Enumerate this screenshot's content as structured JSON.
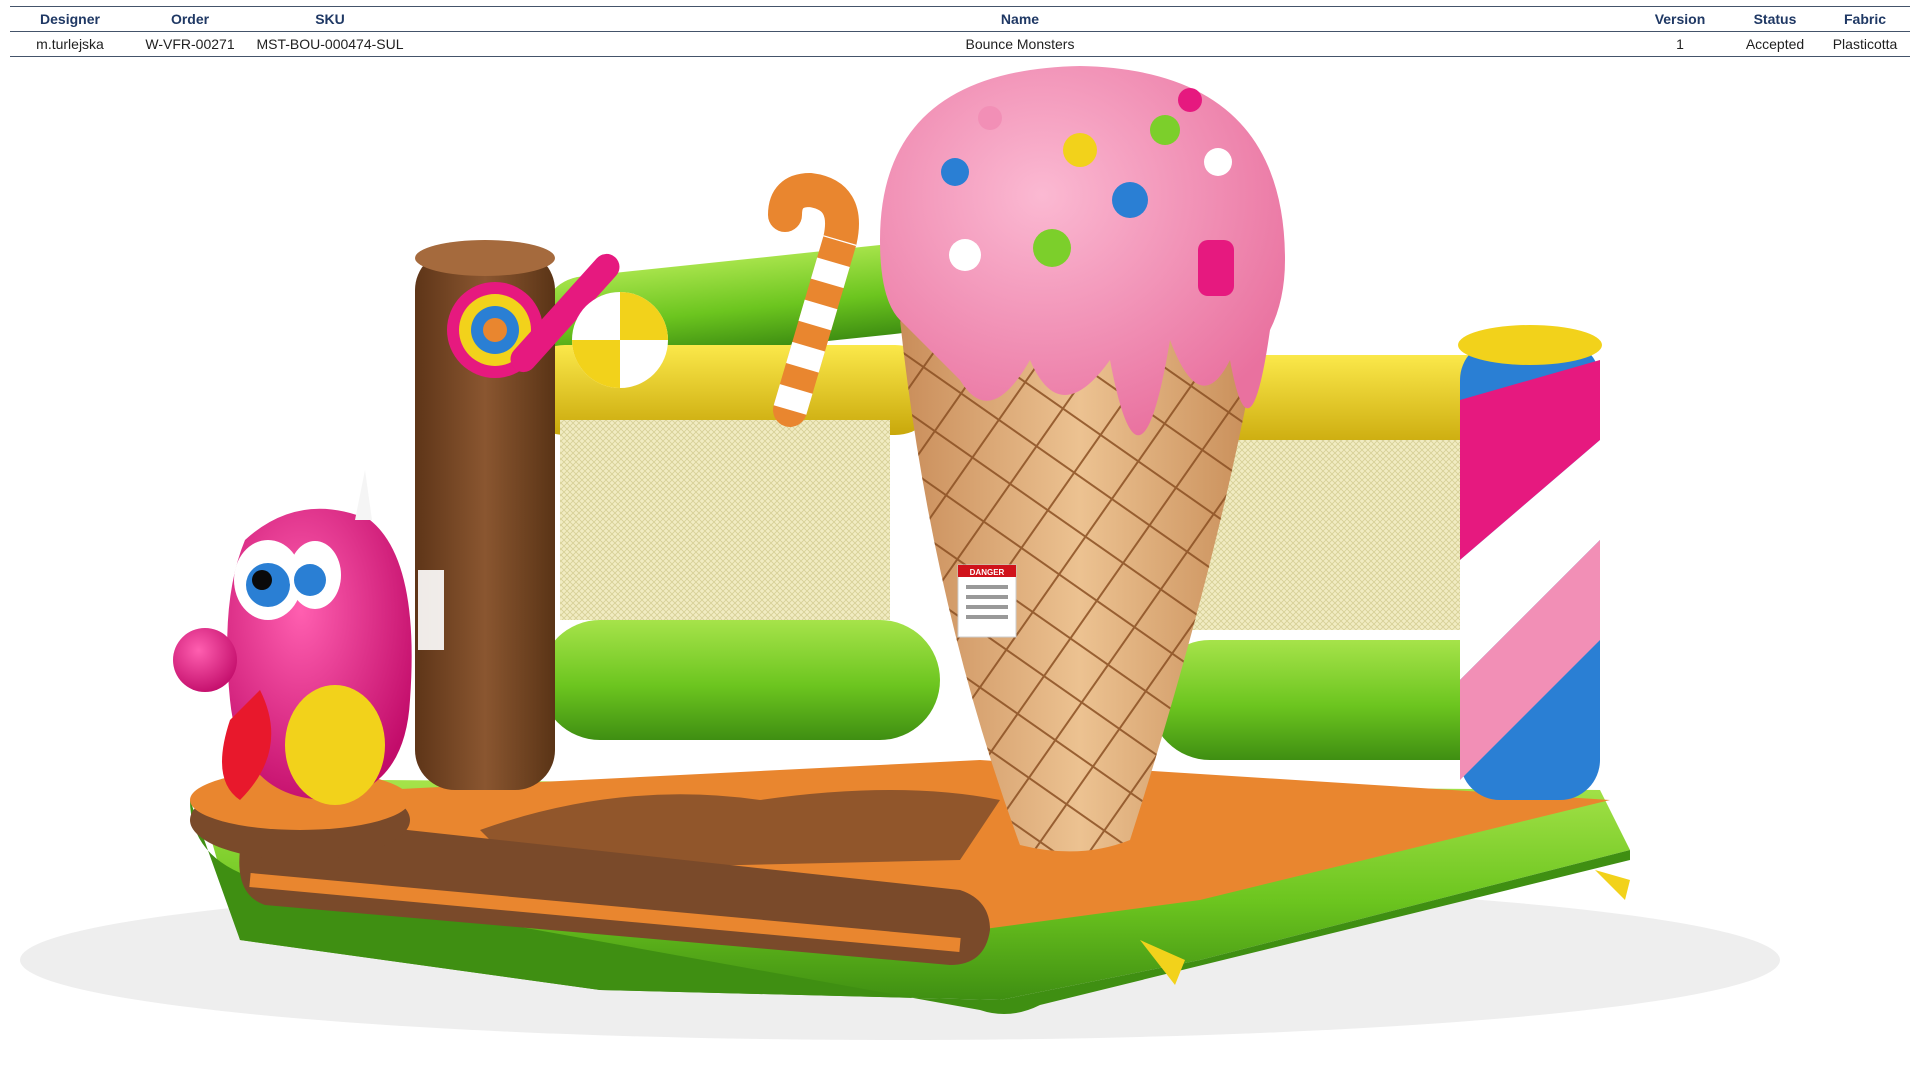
{
  "columns": {
    "designer": "Designer",
    "order": "Order",
    "sku": "SKU",
    "name": "Name",
    "version": "Version",
    "status": "Status",
    "fabric": "Fabric"
  },
  "row": {
    "designer": "m.turlejska",
    "order": "W-VFR-00271",
    "sku": "MST-BOU-000474-SUL",
    "name": "Bounce Monsters",
    "version": "1",
    "status": "Accepted",
    "fabric": "Plasticotta"
  },
  "render": {
    "icon": "bounce-castle-render",
    "warning_label": "DANGER",
    "colors": {
      "green": "#7ccf2b",
      "yellow": "#f2d21b",
      "orange": "#e9862f",
      "brown": "#7a4a2a",
      "pink": "#f28fb6",
      "magenta": "#e6197f",
      "blue": "#2a7fd4",
      "cone": "#e7b07a"
    }
  }
}
